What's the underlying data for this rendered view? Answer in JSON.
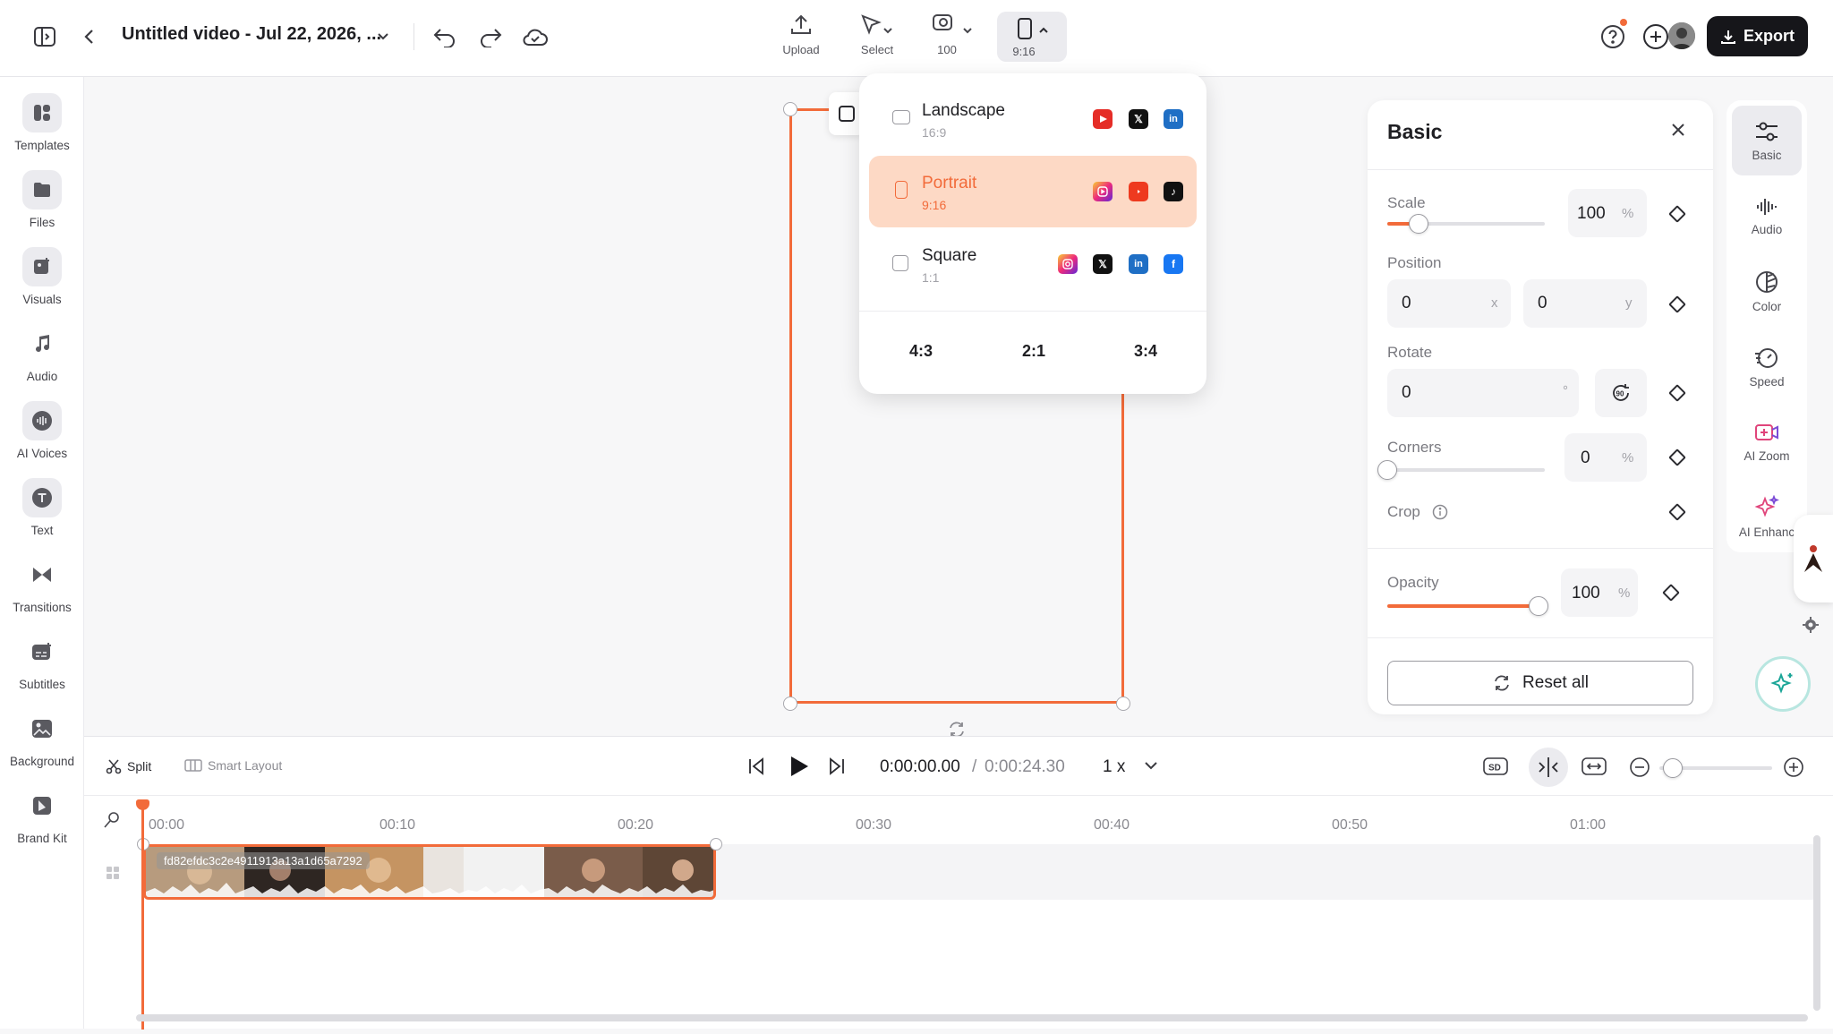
{
  "header": {
    "title": "Untitled video - Jul 22, 2026, ...",
    "tools": {
      "upload": "Upload",
      "select": "Select",
      "zoom": "100",
      "aspect": "9:16"
    },
    "export_label": "Export"
  },
  "sidebar": {
    "items": [
      {
        "label": "Templates",
        "icon": "templates-icon"
      },
      {
        "label": "Files",
        "icon": "folder-icon"
      },
      {
        "label": "Visuals",
        "icon": "visuals-icon"
      },
      {
        "label": "Audio",
        "icon": "music-icon"
      },
      {
        "label": "AI Voices",
        "icon": "ai-voices-icon"
      },
      {
        "label": "Text",
        "icon": "text-icon"
      },
      {
        "label": "Transitions",
        "icon": "transitions-icon"
      },
      {
        "label": "Subtitles",
        "icon": "subtitles-icon"
      },
      {
        "label": "Background",
        "icon": "background-icon"
      },
      {
        "label": "Brand Kit",
        "icon": "brand-kit-icon"
      }
    ]
  },
  "aspect_menu": {
    "options": [
      {
        "name": "Landscape",
        "ratio": "16:9",
        "selected": false
      },
      {
        "name": "Portrait",
        "ratio": "9:16",
        "selected": true
      },
      {
        "name": "Square",
        "ratio": "1:1",
        "selected": false
      }
    ],
    "extra_ratios": [
      "4:3",
      "2:1",
      "3:4"
    ],
    "colors": {
      "selected_bg": "#fdd9c5",
      "accent": "#f26b3a"
    }
  },
  "basic_panel": {
    "title": "Basic",
    "scale": {
      "label": "Scale",
      "value": "100",
      "unit": "%",
      "level": 0.2
    },
    "position": {
      "label": "Position",
      "x": "0",
      "x_unit": "x",
      "y": "0",
      "y_unit": "y"
    },
    "rotate": {
      "label": "Rotate",
      "value": "0",
      "unit": "°"
    },
    "corners": {
      "label": "Corners",
      "value": "0",
      "unit": "%",
      "level": 0
    },
    "crop": {
      "label": "Crop"
    },
    "opacity": {
      "label": "Opacity",
      "value": "100",
      "unit": "%",
      "level": 1
    },
    "reset_label": "Reset all"
  },
  "right_rail": {
    "items": [
      {
        "label": "Basic",
        "icon": "sliders-icon"
      },
      {
        "label": "Audio",
        "icon": "audio-wave-icon"
      },
      {
        "label": "Color",
        "icon": "color-icon"
      },
      {
        "label": "Speed",
        "icon": "speed-icon"
      },
      {
        "label": "AI Zoom",
        "icon": "ai-zoom-icon"
      },
      {
        "label": "AI Enhanc",
        "icon": "ai-enhance-icon"
      }
    ]
  },
  "timeline": {
    "split_label": "Split",
    "smart_layout_label": "Smart Layout",
    "current_time": "0:00:00.00",
    "separator": "/",
    "total_time": "0:00:24.30",
    "speed": "1 x",
    "ruler": [
      "00:00",
      "00:10",
      "00:20",
      "00:30",
      "00:40",
      "00:50",
      "01:00"
    ],
    "clip_name": "fd82efdc3c2e4911913a13a1d65a7292"
  }
}
